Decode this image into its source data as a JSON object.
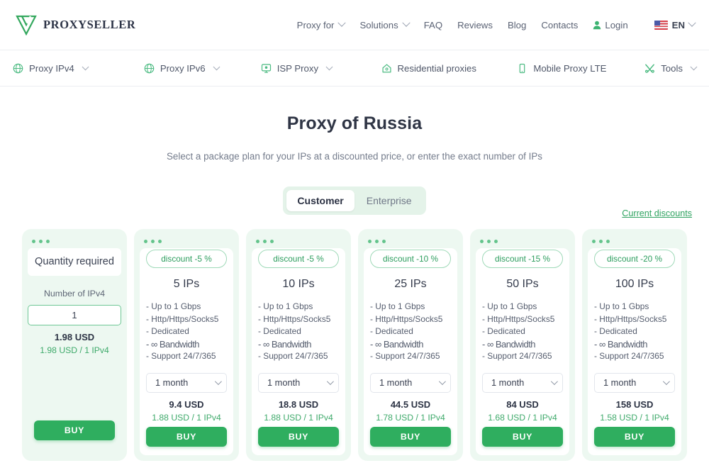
{
  "header": {
    "brand": "PROXYSELLER",
    "logo_icon": "proxyseller-triangle-logo",
    "nav": [
      {
        "label": "Proxy for",
        "has_caret": true
      },
      {
        "label": "Solutions",
        "has_caret": true
      },
      {
        "label": "FAQ",
        "has_caret": false
      },
      {
        "label": "Reviews",
        "has_caret": false
      },
      {
        "label": "Blog",
        "has_caret": false
      },
      {
        "label": "Contacts",
        "has_caret": false
      }
    ],
    "login": "Login",
    "login_icon": "user-icon",
    "language": "EN",
    "flag_icon": "us-flag-icon"
  },
  "subnav": [
    {
      "label": "Proxy IPv4",
      "icon": "globe-icon",
      "has_caret": true
    },
    {
      "label": "Proxy IPv6",
      "icon": "globe-icon",
      "has_caret": true
    },
    {
      "label": "ISP Proxy",
      "icon": "monitor-icon",
      "has_caret": true
    },
    {
      "label": "Residential proxies",
      "icon": "home-icon",
      "has_caret": false
    },
    {
      "label": "Mobile Proxy LTE",
      "icon": "phone-icon",
      "has_caret": false
    },
    {
      "label": "Tools",
      "icon": "tools-icon",
      "has_caret": true
    }
  ],
  "main": {
    "title": "Proxy of Russia",
    "subtitle": "Select a package plan for your IPs at a discounted price, or enter the exact number of IPs",
    "discounts_link": "Current discounts",
    "tabs": [
      {
        "label": "Customer",
        "active": true
      },
      {
        "label": "Enterprise",
        "active": false
      }
    ]
  },
  "quantity_card": {
    "heading": "Quantity required",
    "input_label": "Number of IPv4",
    "input_value": "1",
    "input_placeholder": "1",
    "price_total": "1.98 USD",
    "price_unit": "1.98 USD / 1 IPv4",
    "buy_label": "BUY"
  },
  "plans": [
    {
      "discount": "discount -5 %",
      "ips": "5 IPs",
      "features": [
        "- Up to 1 Gbps",
        "- Http/Https/Socks5",
        "- Dedicated",
        "- ∞ Bandwidth",
        "- Support 24/7/365"
      ],
      "term": "1 month",
      "price_total": "9.4 USD",
      "price_unit": "1.88 USD / 1 IPv4",
      "buy_label": "BUY"
    },
    {
      "discount": "discount -5 %",
      "ips": "10 IPs",
      "features": [
        "- Up to 1 Gbps",
        "- Http/Https/Socks5",
        "- Dedicated",
        "- ∞ Bandwidth",
        "- Support 24/7/365"
      ],
      "term": "1 month",
      "price_total": "18.8 USD",
      "price_unit": "1.88 USD / 1 IPv4",
      "buy_label": "BUY"
    },
    {
      "discount": "discount -10 %",
      "ips": "25 IPs",
      "features": [
        "- Up to 1 Gbps",
        "- Http/Https/Socks5",
        "- Dedicated",
        "- ∞ Bandwidth",
        "- Support 24/7/365"
      ],
      "term": "1 month",
      "price_total": "44.5 USD",
      "price_unit": "1.78 USD / 1 IPv4",
      "buy_label": "BUY"
    },
    {
      "discount": "discount -15 %",
      "ips": "50 IPs",
      "features": [
        "- Up to 1 Gbps",
        "- Http/Https/Socks5",
        "- Dedicated",
        "- ∞ Bandwidth",
        "- Support 24/7/365"
      ],
      "term": "1 month",
      "price_total": "84 USD",
      "price_unit": "1.68 USD / 1 IPv4",
      "buy_label": "BUY"
    },
    {
      "discount": "discount -20 %",
      "ips": "100 IPs",
      "features": [
        "- Up to 1 Gbps",
        "- Http/Https/Socks5",
        "- Dedicated",
        "- ∞ Bandwidth",
        "- Support 24/7/365"
      ],
      "term": "1 month",
      "price_total": "158 USD",
      "price_unit": "1.58 USD / 1 IPv4",
      "buy_label": "BUY"
    }
  ],
  "colors": {
    "brand_green": "#2fae5f",
    "pale_green": "#edf8f1",
    "text_dark": "#2f3545"
  }
}
